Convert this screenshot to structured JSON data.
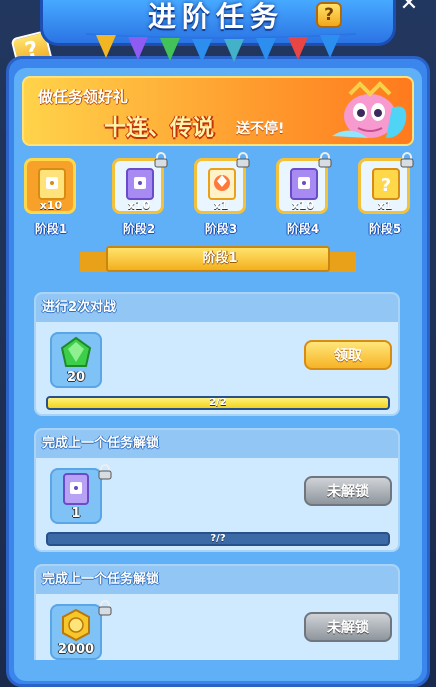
{
  "header": {
    "title": "进阶任务",
    "help_label": "?",
    "close_label": "✕"
  },
  "promo": {
    "line1": "做任务领好礼",
    "line2": "十连、传说",
    "line3": "送不停!"
  },
  "stages": [
    {
      "label": "阶段1",
      "qty": "x10",
      "locked": false,
      "active": true
    },
    {
      "label": "阶段2",
      "qty": "x10",
      "locked": true,
      "active": false
    },
    {
      "label": "阶段3",
      "qty": "x1",
      "locked": true,
      "active": false
    },
    {
      "label": "阶段4",
      "qty": "x10",
      "locked": true,
      "active": false
    },
    {
      "label": "阶段5",
      "qty": "x1",
      "locked": true,
      "active": false
    }
  ],
  "current_stage_title": "阶段1",
  "tasks": [
    {
      "title": "进行2次对战",
      "reward_qty": "20",
      "reward_icon": "green-gem-icon",
      "button": "领取",
      "button_state": "claim",
      "progress_text": "2/2",
      "progress": 1.0,
      "locked": false
    },
    {
      "title": "完成上一个任务解锁",
      "reward_qty": "1",
      "reward_icon": "card-pack-icon",
      "button": "未解锁",
      "button_state": "locked",
      "progress_text": "?/?",
      "progress": 0,
      "locked": true
    },
    {
      "title": "完成上一个任务解锁",
      "reward_qty": "2000",
      "reward_icon": "gold-coin-icon",
      "button": "未解锁",
      "button_state": "locked",
      "progress_text": "",
      "progress": 0,
      "locked": true
    }
  ],
  "colors": {
    "panel": "#3a86ec",
    "claim": "#f6b326",
    "locked": "#8e959c",
    "progress": "#f4d21e"
  }
}
